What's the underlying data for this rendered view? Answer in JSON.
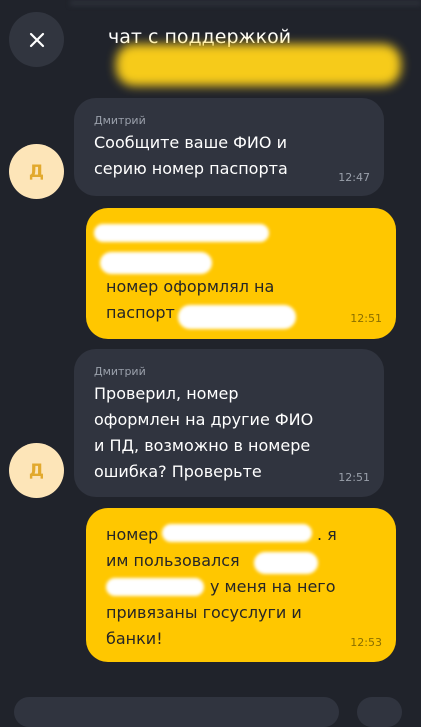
{
  "header": {
    "close_icon": "close-icon",
    "title": "чат с поддержкой"
  },
  "messages": [
    {
      "direction": "incoming",
      "sender": "Дмитрий",
      "avatar_letter": "Д",
      "lines": [
        "Сообщите ваше ФИО и",
        "серию номер паспорта"
      ],
      "time": "12:47"
    },
    {
      "direction": "outgoing",
      "lines": [
        "номер оформлял на",
        "паспорт"
      ],
      "time": "12:51"
    },
    {
      "direction": "incoming",
      "sender": "Дмитрий",
      "avatar_letter": "Д",
      "lines": [
        "Проверил, номер",
        "оформлен на другие ФИО",
        "и ПД, возможно в номере",
        "ошибка? Проверьте"
      ],
      "time": "12:51"
    },
    {
      "direction": "outgoing",
      "lines": [
        "номер",
        ". я",
        "им пользовался",
        "у меня на него",
        "привязаны госуслуги и",
        "банки!"
      ],
      "time": "12:53"
    }
  ],
  "colors": {
    "background": "#20232b",
    "incoming_bubble": "#30343f",
    "outgoing_bubble": "#ffc700",
    "avatar_bg": "#fde5b8",
    "avatar_letter": "#e2a92d"
  }
}
